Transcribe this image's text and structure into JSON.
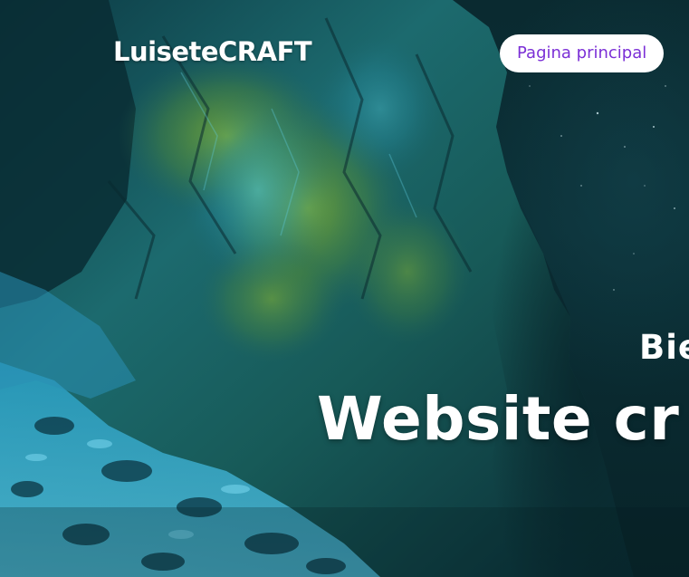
{
  "header": {
    "logo_text": "LuiseteCRAFT",
    "nav_button_label": "Pagina principal"
  },
  "hero": {
    "greeting": "Bie",
    "headline": "Website cr"
  },
  "colors": {
    "nav_button_text": "#7b2fd6",
    "nav_button_bg": "#ffffff",
    "text": "#ffffff",
    "sky": "#0b2f36",
    "rock_highlight": "#3fb8d8",
    "moss": "#6c9b2a"
  }
}
